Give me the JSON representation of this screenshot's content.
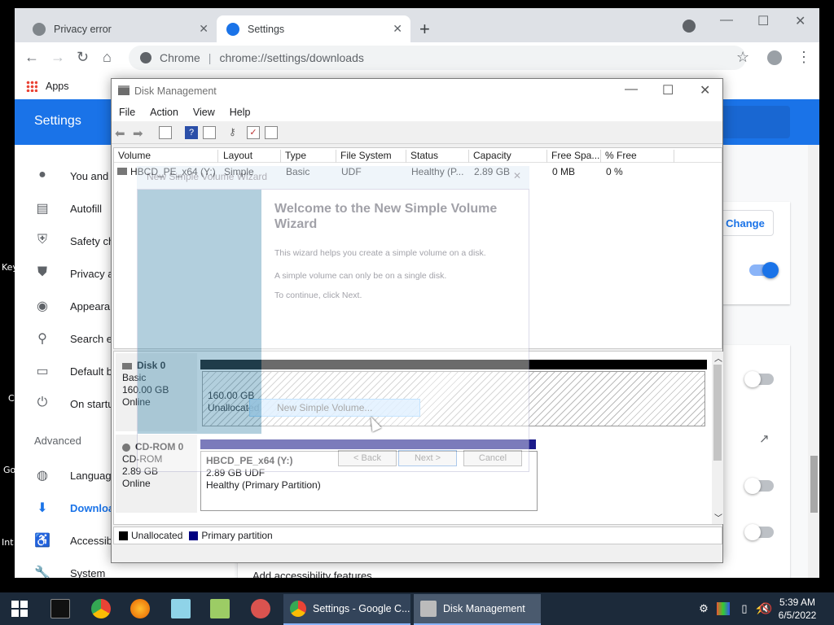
{
  "desktop": {
    "labels": [
      "Key",
      "C",
      "Go",
      "Int"
    ]
  },
  "chrome": {
    "tabs": [
      {
        "label": "Privacy error",
        "icon": "warning-globe-icon",
        "active": false
      },
      {
        "label": "Settings",
        "icon": "gear-icon",
        "active": true
      }
    ],
    "omnibox": {
      "site": "Chrome",
      "url": "chrome://settings/downloads"
    },
    "bookmarks": {
      "apps": "Apps"
    },
    "settings_title": "Settings",
    "sidebar": [
      {
        "label": "You and",
        "icon": "person-icon"
      },
      {
        "label": "Autofill",
        "icon": "clipboard-icon"
      },
      {
        "label": "Safety ch",
        "icon": "shield-check-icon"
      },
      {
        "label": "Privacy a",
        "icon": "shield-icon"
      },
      {
        "label": "Appeara",
        "icon": "palette-icon"
      },
      {
        "label": "Search e",
        "icon": "search-icon"
      },
      {
        "label": "Default b",
        "icon": "browser-icon"
      },
      {
        "label": "On startu",
        "icon": "power-icon"
      },
      {
        "label": "Languag",
        "icon": "globe-icon"
      },
      {
        "label": "Downloa",
        "icon": "download-icon",
        "active": true
      },
      {
        "label": "Accessib",
        "icon": "accessibility-icon"
      },
      {
        "label": "System",
        "icon": "wrench-icon"
      }
    ],
    "advanced": "Advanced",
    "change_button": "Change",
    "toggles": {
      "top": true,
      "row1": false,
      "row2": false,
      "row3": false
    },
    "a11y_link": "Add accessibility features"
  },
  "disk_management": {
    "title": "Disk Management",
    "menu": [
      "File",
      "Action",
      "View",
      "Help"
    ],
    "columns": [
      "Volume",
      "Layout",
      "Type",
      "File System",
      "Status",
      "Capacity",
      "Free Spa...",
      "% Free"
    ],
    "rows": [
      {
        "volume": "HBCD_PE_x64 (Y:)",
        "layout": "Simple",
        "type": "Basic",
        "fs": "UDF",
        "status": "Healthy (P...",
        "capacity": "2.89 GB",
        "free": "0 MB",
        "pct_free": "0 %"
      }
    ],
    "disks": [
      {
        "name": "Disk 0",
        "kind": "Basic",
        "size": "160.00 GB",
        "state": "Online",
        "partition": {
          "size": "160.00 GB",
          "status": "Unallocated"
        }
      },
      {
        "name": "CD-ROM 0",
        "kind": "CD-ROM",
        "size": "2.89 GB",
        "state": "Online",
        "partition": {
          "name": "HBCD_PE_x64  (Y:)",
          "size": "2.89 GB UDF",
          "status": "Healthy (Primary Partition)"
        }
      }
    ],
    "context_item": "New Simple Volume...",
    "legend": [
      {
        "label": "Unallocated",
        "color": "#000000"
      },
      {
        "label": "Primary partition",
        "color": "#000080"
      }
    ]
  },
  "wizard": {
    "title": "New Simple Volume Wizard",
    "heading": "Welcome to the New Simple Volume Wizard",
    "p1": "This wizard helps you create a simple volume on a disk.",
    "p2": "A simple volume can only be on a single disk.",
    "p3": "To continue, click Next.",
    "back": "< Back",
    "next": "Next >",
    "cancel": "Cancel"
  },
  "taskbar": {
    "tasks": [
      {
        "label": "Settings - Google C...",
        "icon": "chrome-icon"
      },
      {
        "label": "Disk Management",
        "icon": "disk-management-icon"
      }
    ],
    "time": "5:39 AM",
    "date": "6/5/2022"
  }
}
